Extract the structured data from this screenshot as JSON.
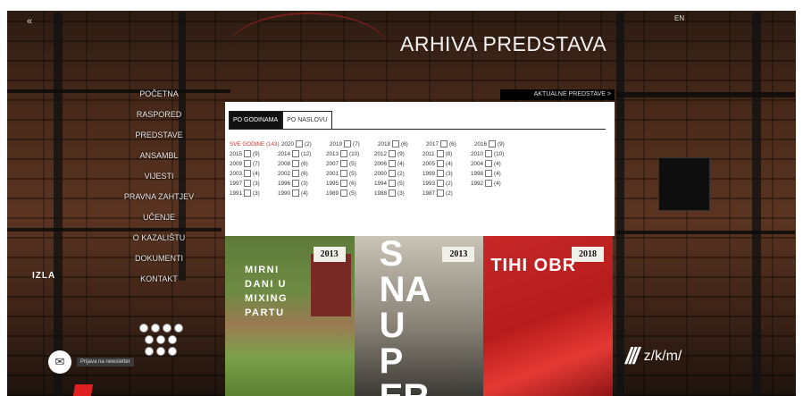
{
  "header": {
    "page_title": "ARHIVA PREDSTAVA",
    "lang": "EN",
    "back_icon": "«"
  },
  "nav": {
    "items": [
      "POČETNA",
      "RASPORED",
      "PREDSTAVE",
      "ANSAMBL",
      "VIJESTI",
      "PRAVNA ZAHTJEV",
      "UČENJE",
      "O KAZALIŠTU",
      "DOKUMENTI",
      "KONTAKT"
    ]
  },
  "aktualne_link": "AKTUALNE PREDSTAVE >",
  "filter": {
    "tabs": [
      "PO GODINAMA",
      "PO NASLOVU"
    ],
    "all_label": "SVE GODINE",
    "all_count": "(143)",
    "years": [
      [
        [
          "2020",
          "(2)"
        ],
        [
          "2019",
          "(7)"
        ],
        [
          "2018",
          "(6)"
        ],
        [
          "2017",
          "(6)"
        ],
        [
          "2016",
          "(9)"
        ]
      ],
      [
        [
          "2015",
          "(9)"
        ],
        [
          "2014",
          "(12)"
        ],
        [
          "2013",
          "(10)"
        ],
        [
          "2012",
          "(9)"
        ],
        [
          "2011",
          "(8)"
        ],
        [
          "2010",
          "(10)"
        ]
      ],
      [
        [
          "2009",
          "(7)"
        ],
        [
          "2008",
          "(6)"
        ],
        [
          "2007",
          "(5)"
        ],
        [
          "2006",
          "(4)"
        ],
        [
          "2005",
          "(4)"
        ],
        [
          "2004",
          "(4)"
        ]
      ],
      [
        [
          "2003",
          "(4)"
        ],
        [
          "2002",
          "(6)"
        ],
        [
          "2001",
          "(5)"
        ],
        [
          "2000",
          "(2)"
        ],
        [
          "1999",
          "(3)"
        ],
        [
          "1998",
          "(4)"
        ]
      ],
      [
        [
          "1997",
          "(3)"
        ],
        [
          "1996",
          "(3)"
        ],
        [
          "1995",
          "(6)"
        ],
        [
          "1994",
          "(5)"
        ],
        [
          "1993",
          "(2)"
        ],
        [
          "1992",
          "(4)"
        ]
      ],
      [
        [
          "1991",
          "(3)"
        ],
        [
          "1990",
          "(4)"
        ],
        [
          "1989",
          "(5)"
        ],
        [
          "1988",
          "(3)"
        ],
        [
          "1987",
          "(2)"
        ]
      ]
    ]
  },
  "posters": [
    {
      "year": "2013",
      "title_lines": [
        "MIRNI",
        "DANI U",
        "MIXING",
        "PARTU"
      ]
    },
    {
      "year": "2013",
      "title_lines": [
        "S",
        "NA",
        "U",
        "P",
        "ER"
      ]
    },
    {
      "year": "2018",
      "title_lines": [
        "TIHI OBR"
      ]
    }
  ],
  "footer": {
    "newsletter_label": "Prijava na newsletter",
    "zkm_mark": "///",
    "zkm_text": "z/k/m/",
    "crest_text": "IZLA",
    "email_icon": "✉"
  }
}
